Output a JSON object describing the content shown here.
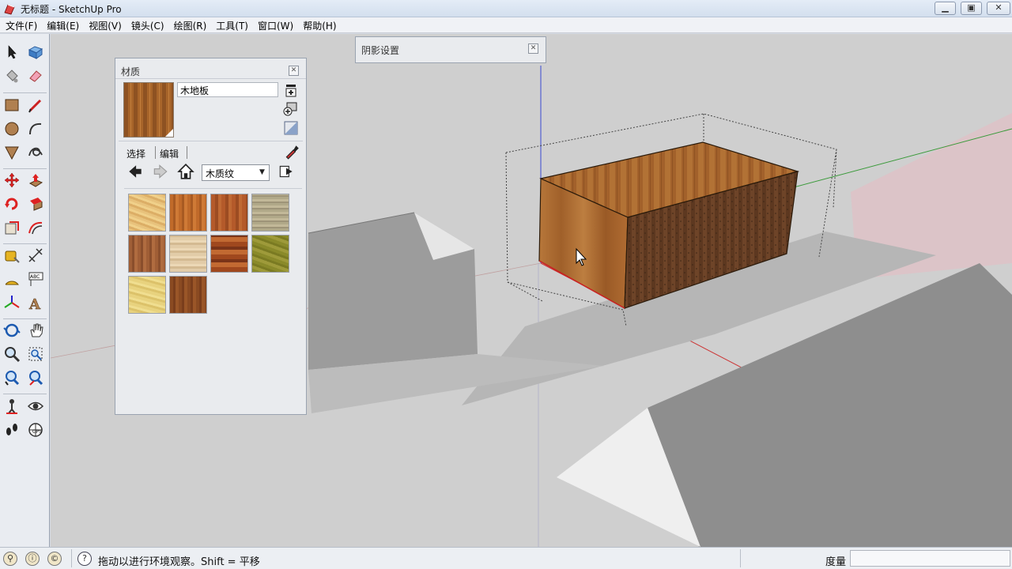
{
  "window": {
    "title": "无标题 - SketchUp Pro"
  },
  "menu": {
    "items": [
      "文件(F)",
      "编辑(E)",
      "视图(V)",
      "镜头(C)",
      "绘图(R)",
      "工具(T)",
      "窗口(W)",
      "帮助(H)"
    ]
  },
  "materials_panel": {
    "title": "材质",
    "material_name": "木地板",
    "tabs": [
      "选择",
      "编辑"
    ],
    "library": "木质纹",
    "swatches": [
      "light-maple",
      "cherry",
      "mahogany",
      "driftwood",
      "walnut",
      "light-oak",
      "parquet-mix",
      "olive-veneer",
      "pine",
      "dark-cherry"
    ]
  },
  "shadow_panel": {
    "title": "阴影设置"
  },
  "status": {
    "message": "拖动以进行环境观察。Shift = 平移",
    "measure_label": "度量",
    "measure_value": ""
  },
  "colors": {
    "accent_red_axis": "#cc2222",
    "accent_green_axis": "#2a9a2a",
    "accent_blue_axis": "#2a3acc",
    "wood": "#a8652a"
  }
}
